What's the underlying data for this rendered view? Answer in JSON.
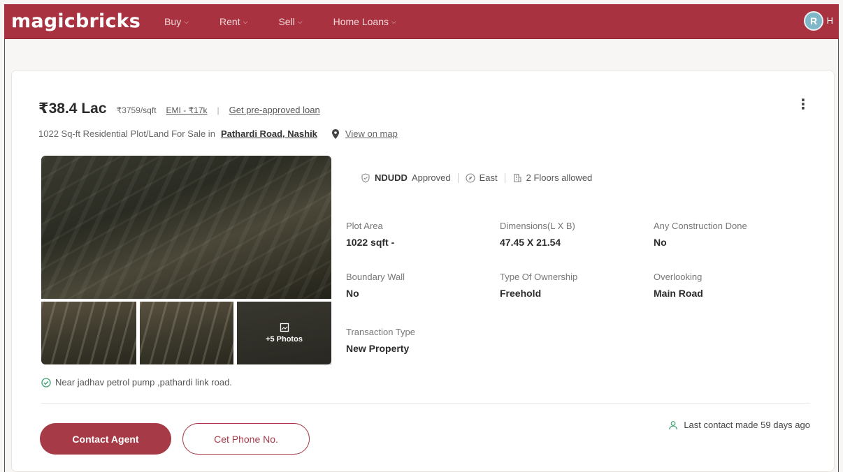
{
  "nav": {
    "logo": "magicbricks",
    "items": [
      {
        "label": "Buy"
      },
      {
        "label": "Rent"
      },
      {
        "label": "Sell"
      },
      {
        "label": "Home Loans"
      }
    ],
    "avatar_initial": "R",
    "user_initial": "H"
  },
  "listing": {
    "price": "₹38.4 Lac",
    "price_per_sqft": "₹3759/sqft",
    "emi": "EMI - ₹17k",
    "separator": "|",
    "preapproved_loan": "Get pre-approved loan",
    "title_prefix": "1022 Sq-ft Residential Plot/Land For Sale in",
    "location": "Pathardi Road, Nashik",
    "view_on_map": "View on map",
    "more_photos": "+5 Photos",
    "landmark": "Near jadhav petrol pump ,pathardi link road.",
    "badges": {
      "approval_name": "NDUDD",
      "approval_suffix": "Approved",
      "facing": "East",
      "floors": "2 Floors allowed"
    },
    "details": {
      "plot_area_label": "Plot Area",
      "plot_area_value": "1022 sqft -",
      "dimensions_label": "Dimensions(L X B)",
      "dimensions_value": "47.45 X 21.54",
      "construction_label": "Any Construction Done",
      "construction_value": "No",
      "boundary_label": "Boundary Wall",
      "boundary_value": "No",
      "ownership_label": "Type Of Ownership",
      "ownership_value": "Freehold",
      "overlooking_label": "Overlooking",
      "overlooking_value": "Main Road",
      "transaction_label": "Transaction Type",
      "transaction_value": "New Property"
    },
    "contact_agent": "Contact Agent",
    "get_phone": "Cet Phone No.",
    "last_contact": "Last contact made 59 days ago"
  },
  "colors": {
    "brand": "#a8323f",
    "accent": "#a73a47",
    "check_green": "#3aa371"
  }
}
